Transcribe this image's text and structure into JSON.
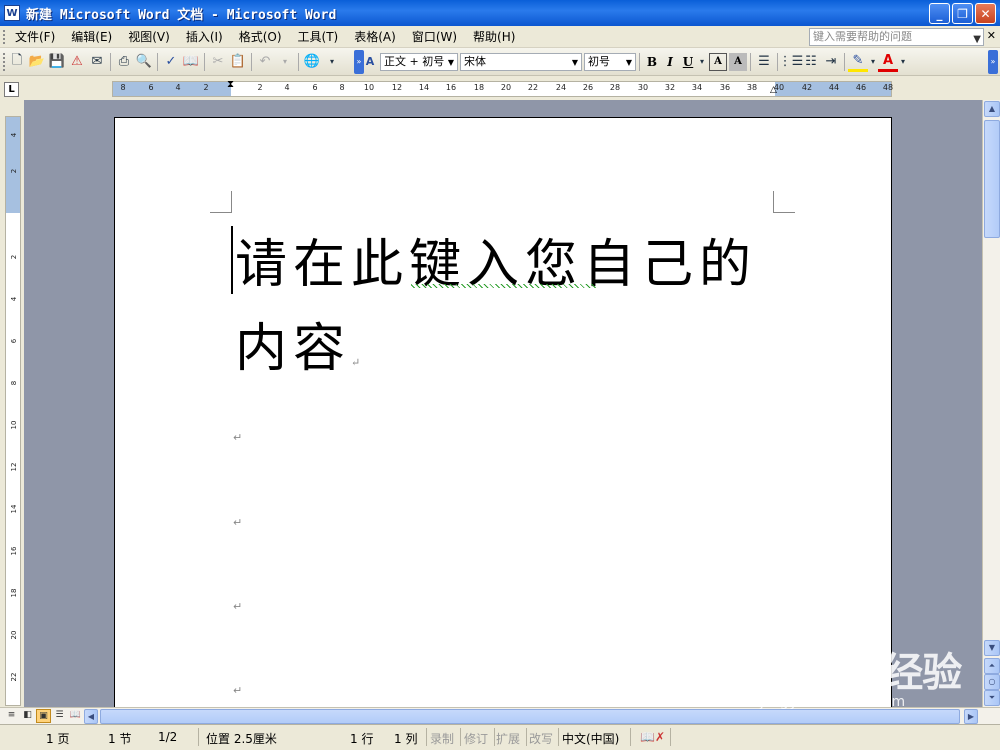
{
  "window": {
    "title": "新建 Microsoft Word 文档 - Microsoft Word",
    "min_icon": "minimize-icon",
    "max_icon": "restore-icon",
    "close_icon": "close-icon"
  },
  "menubar": {
    "items": [
      "文件(F)",
      "编辑(E)",
      "视图(V)",
      "插入(I)",
      "格式(O)",
      "工具(T)",
      "表格(A)",
      "窗口(W)",
      "帮助(H)"
    ],
    "help_placeholder": "键入需要帮助的问题"
  },
  "toolbar": {
    "style": "正文 + 初号",
    "font": "宋体",
    "size": "初号",
    "bold": "B",
    "italic": "I",
    "underline": "U"
  },
  "ruler": {
    "h_ticks": [
      "8",
      "6",
      "4",
      "2",
      "2",
      "4",
      "6",
      "8",
      "10",
      "12",
      "14",
      "16",
      "18",
      "20",
      "22",
      "24",
      "26",
      "28",
      "30",
      "32",
      "34",
      "36",
      "38",
      "40",
      "42",
      "44",
      "46",
      "48"
    ],
    "v_ticks": [
      "4",
      "2",
      "2",
      "4",
      "6",
      "8",
      "10",
      "12",
      "14",
      "16",
      "18",
      "20",
      "22"
    ]
  },
  "document": {
    "text": "请在此键入您自己的内容"
  },
  "statusbar": {
    "page": "1 页",
    "section": "1 节",
    "page_of": "1/2",
    "position": "位置 2.5厘米",
    "line": "1 行",
    "column": "1 列",
    "rec": "录制",
    "trk": "修订",
    "ext": "扩展",
    "ovr": "改写",
    "language": "中文(中国)"
  },
  "watermark": {
    "logo": "Baidu经验",
    "url": "jingyan.baidu.com"
  },
  "colors": {
    "titlebar": "#0a5fd8",
    "workspace": "#8f96a8",
    "ruler_margin": "#a6c0e0",
    "spelling": "#2a9d2a"
  }
}
